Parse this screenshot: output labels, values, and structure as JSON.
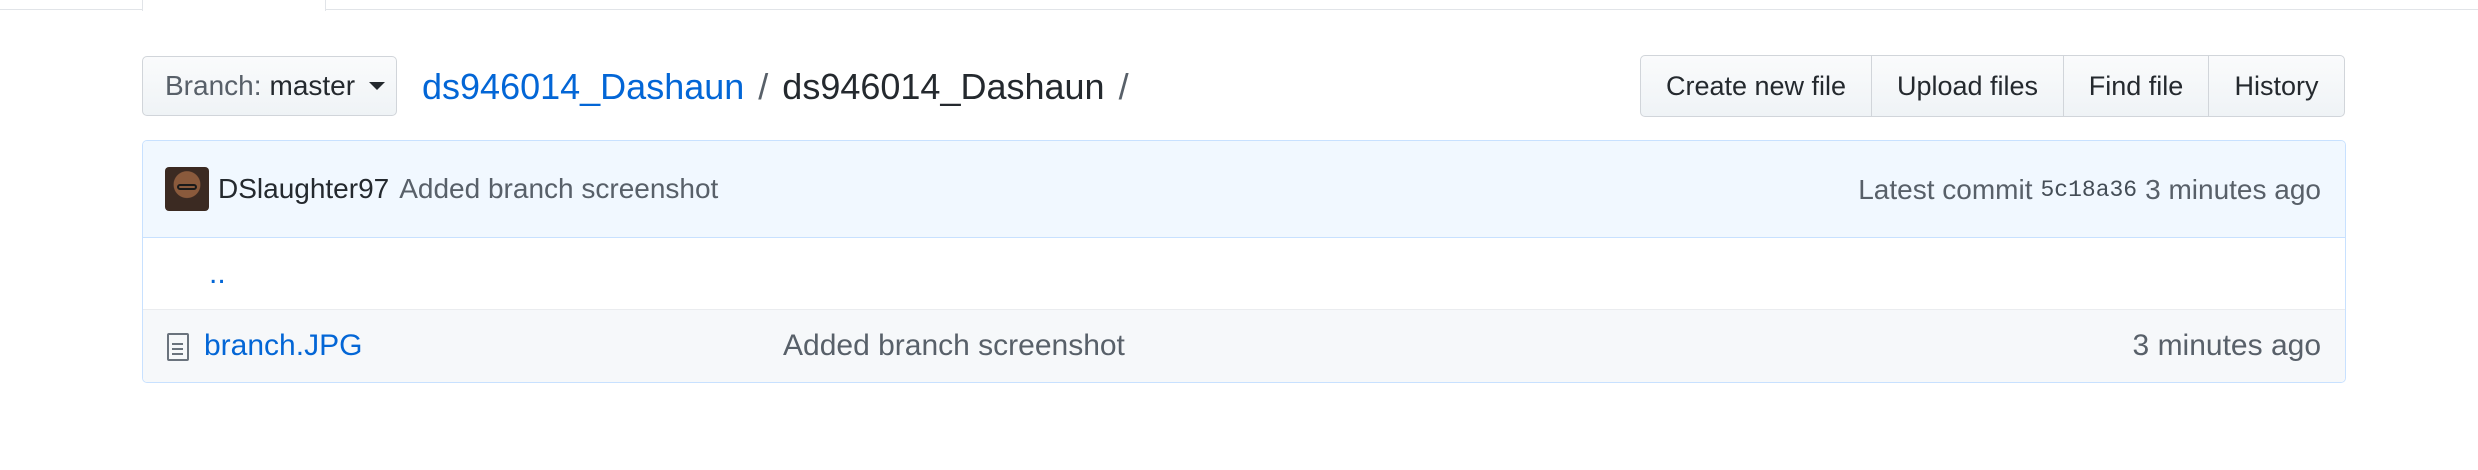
{
  "branch": {
    "label": "Branch:",
    "value": "master"
  },
  "breadcrumb": {
    "repo": "ds946014_Dashaun",
    "separator": "/",
    "dir": "ds946014_Dashaun",
    "trailing": "/"
  },
  "actions": {
    "create": "Create new file",
    "upload": "Upload files",
    "find": "Find file",
    "history": "History"
  },
  "commit": {
    "author": "DSlaughter97",
    "message": "Added branch screenshot",
    "latest_label": "Latest commit",
    "sha": "5c18a36",
    "age": "3 minutes ago"
  },
  "files": {
    "parent": "..",
    "rows": [
      {
        "name": "branch.JPG",
        "message": "Added branch screenshot",
        "age": "3 minutes ago",
        "icon": "file-icon"
      }
    ]
  },
  "colors": {
    "link": "#0366d6",
    "commit_bg": "#f1f8ff",
    "border": "#c8e1ff"
  }
}
